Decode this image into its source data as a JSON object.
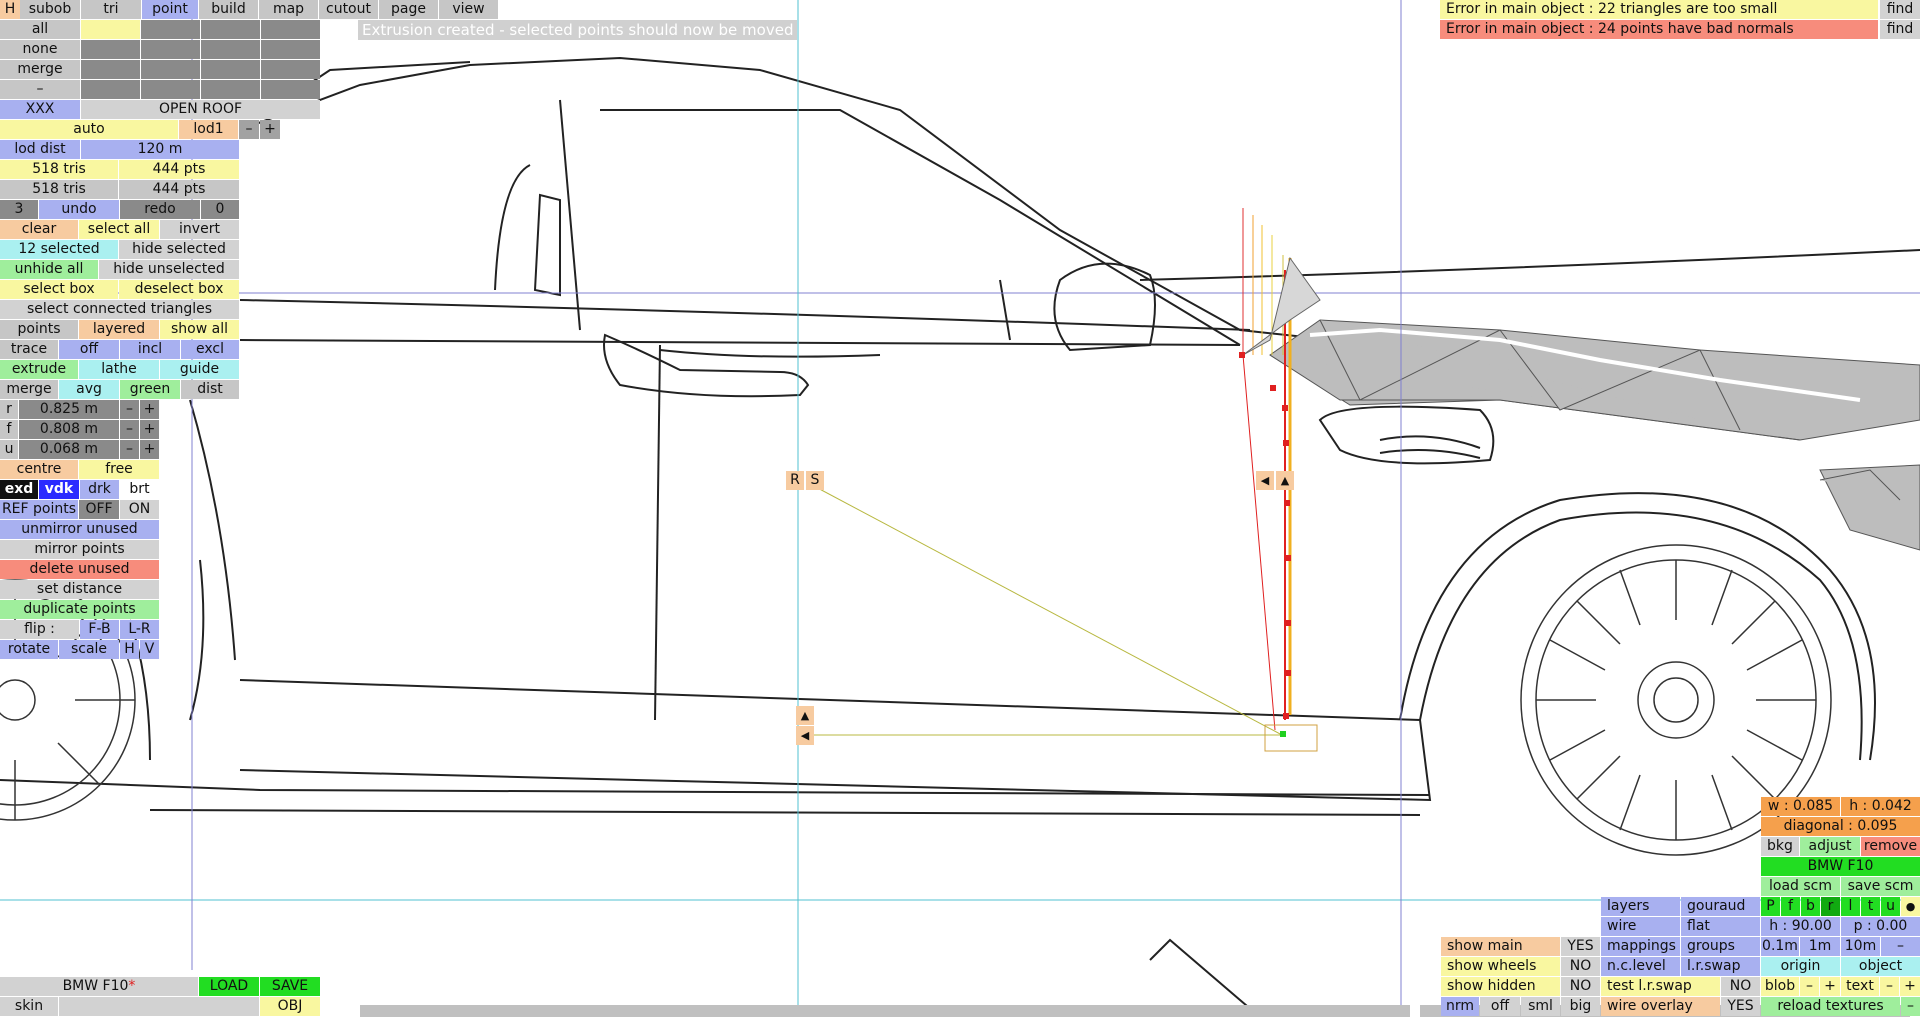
{
  "top_menu": {
    "h": "H",
    "subob": "subob",
    "tri": "tri",
    "point": "point",
    "build": "build",
    "map": "map",
    "cutout": "cutout",
    "page": "page",
    "view": "view"
  },
  "notice": "Extrusion created - selected points should now be moved",
  "errors": [
    {
      "text": "Error in main object : 22 triangles are too small",
      "find": "find"
    },
    {
      "text": "Error in main object : 24 points have bad normals",
      "find": "find"
    }
  ],
  "left": {
    "all": "all",
    "none": "none",
    "merge": "merge",
    "dash": "–",
    "xxx": "XXX",
    "open_roof": "OPEN ROOF",
    "auto": "auto",
    "lod1": "lod1",
    "minus": "–",
    "plus": "+",
    "lod_dist": "lod dist",
    "lod_dist_val": "120 m",
    "tris1": "518 tris",
    "pts1": "444 pts",
    "tris2": "518 tris",
    "pts2": "444 pts",
    "undo_n": "3",
    "undo": "undo",
    "redo": "redo",
    "redo_n": "0",
    "clear": "clear",
    "select_all": "select all",
    "invert": "invert",
    "selected": "12 selected",
    "hide_selected": "hide selected",
    "unhide_all": "unhide all",
    "hide_unselected": "hide unselected",
    "select_box": "select box",
    "deselect_box": "deselect box",
    "select_connected": "select connected triangles",
    "points": "points",
    "layered": "layered",
    "show_all": "show all",
    "trace": "trace",
    "off": "off",
    "incl": "incl",
    "excl": "excl",
    "extrude": "extrude",
    "lathe": "lathe",
    "guide": "guide",
    "merge2": "merge",
    "avg": "avg",
    "green": "green",
    "dist": "dist",
    "r": "r",
    "r_val": "0.825 m",
    "f": "f",
    "f_val": "0.808 m",
    "u": "u",
    "u_val": "0.068 m",
    "centre": "centre",
    "free": "free",
    "exd": "exd",
    "vdk": "vdk",
    "drk": "drk",
    "brt": "brt",
    "ref_points": "REF points",
    "ref_off": "OFF",
    "ref_on": "ON",
    "unmirror": "unmirror unused",
    "mirror": "mirror points",
    "delete_unused": "delete unused",
    "set_distance": "set distance",
    "duplicate": "duplicate points",
    "flip": "flip :",
    "fb": "F-B",
    "lr": "L-R",
    "rotate": "rotate",
    "scale": "scale",
    "hh": "H",
    "vv": "V"
  },
  "bottom_left": {
    "name": "BMW F10",
    "mark": "*",
    "load": "LOAD",
    "save": "SAVE",
    "skin": "skin",
    "obj": "OBJ"
  },
  "handles": {
    "r": "R",
    "s": "S",
    "up": "▲",
    "left": "◀"
  },
  "right": {
    "w": "w : 0.085",
    "h": "h : 0.042",
    "diagonal": "diagonal : 0.095",
    "bkg": "bkg",
    "adjust": "adjust",
    "remove": "remove",
    "title": "BMW F10",
    "load_scm": "load scm",
    "save_scm": "save scm",
    "views": [
      "P",
      "f",
      "b",
      "r",
      "l",
      "t",
      "u"
    ],
    "dot": "●",
    "h_val": "h : 90.00",
    "p_val": "p : 0.00",
    "d01": "0.1m",
    "d1": "1m",
    "d10": "10m",
    "dminus": "–",
    "origin": "origin",
    "object": "object",
    "blob": "blob",
    "text": "text",
    "minus": "–",
    "plus": "+",
    "reload": "reload textures",
    "layers": "layers",
    "gouraud": "gouraud",
    "wire": "wire",
    "flat": "flat",
    "mappings": "mappings",
    "groups": "groups",
    "nc_level": "n.c.level",
    "lr_swap": "l.r.swap",
    "test_lr_swap": "test l.r.swap",
    "no": "NO",
    "wire_overlay": "wire overlay",
    "yes": "YES",
    "show_main": "show main",
    "show_wheels": "show wheels",
    "show_hidden": "show hidden",
    "nrm": "nrm",
    "off": "off",
    "sml": "sml",
    "big": "big"
  }
}
